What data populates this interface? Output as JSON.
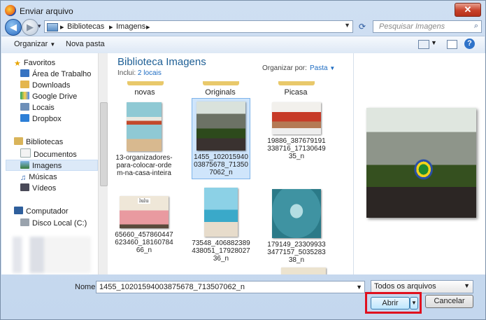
{
  "window": {
    "title": "Enviar arquivo",
    "close_label": "✕"
  },
  "nav": {
    "breadcrumb": [
      "Bibliotecas",
      "Imagens"
    ],
    "search_placeholder": "Pesquisar Imagens"
  },
  "toolbar": {
    "organize_label": "Organizar",
    "new_folder_label": "Nova pasta",
    "help_label": "?"
  },
  "sidebar": {
    "favorites": {
      "label": "Favoritos",
      "items": [
        "Área de Trabalho",
        "Downloads",
        "Google Drive",
        "Locais",
        "Dropbox"
      ]
    },
    "libraries": {
      "label": "Bibliotecas",
      "items": [
        "Documentos",
        "Imagens",
        "Músicas",
        "Vídeos"
      ],
      "selected": "Imagens"
    },
    "computer": {
      "label": "Computador",
      "items": [
        "Disco Local (C:)"
      ]
    }
  },
  "library": {
    "title": "Biblioteca Imagens",
    "includes_label": "Inclui:",
    "includes_link": "2 locais",
    "arrange_label": "Organizar por:",
    "arrange_value": "Pasta"
  },
  "files": {
    "top_row": [
      "novas",
      "Originals",
      "Picasa"
    ],
    "row1": [
      "13-organizadores-para-colocar-ordem-na-casa-inteira",
      "1455_10201594003875678_713507062_n",
      "19886_387679191338716_1713064935_n"
    ],
    "row2": [
      "65660_457860447623460_1816078466_n",
      "73548_406882389438051_1792802736_n",
      "179149_233099333477157_503528338_n"
    ],
    "selected": "1455_10201594003875678_713507062_n",
    "thumb_labels": {
      "lulu": "lulu"
    }
  },
  "footer": {
    "name_label": "Nome:",
    "name_value": "1455_10201594003875678_713507062_n",
    "filter_value": "Todos os arquivos",
    "open_label": "Abrir",
    "cancel_label": "Cancelar"
  },
  "colors": {
    "accent": "#1e5f95",
    "highlight": "#e0101e",
    "selection": "#cfe5fb"
  }
}
